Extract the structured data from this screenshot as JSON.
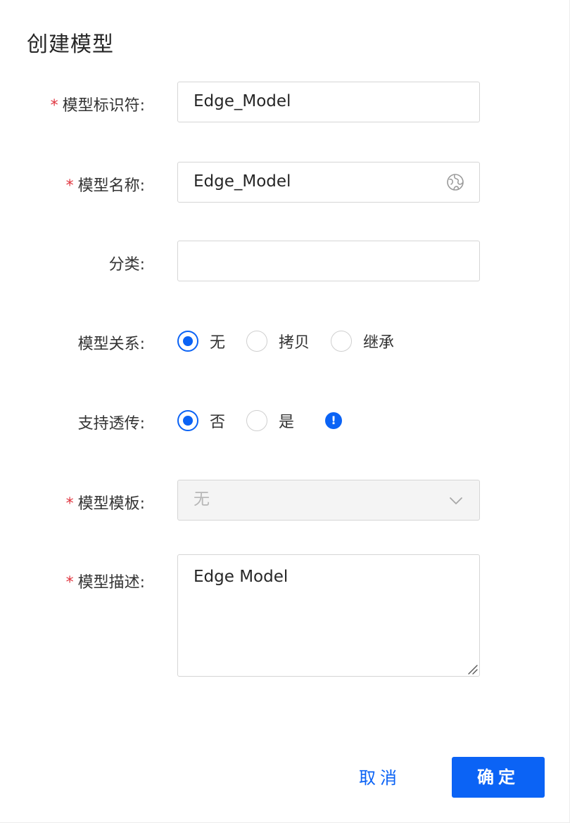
{
  "dialog": {
    "title": "创建模型",
    "colors": {
      "primary": "#0b63f5",
      "required": "#e0353f"
    }
  },
  "form": {
    "required_mark": "*",
    "identifier": {
      "label": "模型标识符:",
      "value": "Edge_Model",
      "required": true
    },
    "name": {
      "label": "模型名称:",
      "value": "Edge_Model",
      "required": true,
      "suffix_icon": "globe-icon"
    },
    "category": {
      "label": "分类:",
      "value": ""
    },
    "relation": {
      "label": "模型关系:",
      "options": [
        {
          "label": "无",
          "checked": true
        },
        {
          "label": "拷贝",
          "checked": false
        },
        {
          "label": "继承",
          "checked": false
        }
      ]
    },
    "passthrough": {
      "label": "支持透传:",
      "options": [
        {
          "label": "否",
          "checked": true
        },
        {
          "label": "是",
          "checked": false
        }
      ],
      "info_icon": "!"
    },
    "template": {
      "label": "模型模板:",
      "value": "无",
      "required": true,
      "disabled": true
    },
    "description": {
      "label": "模型描述:",
      "value": "Edge Model",
      "required": true
    }
  },
  "footer": {
    "cancel_label": "取消",
    "ok_label": "确定"
  }
}
